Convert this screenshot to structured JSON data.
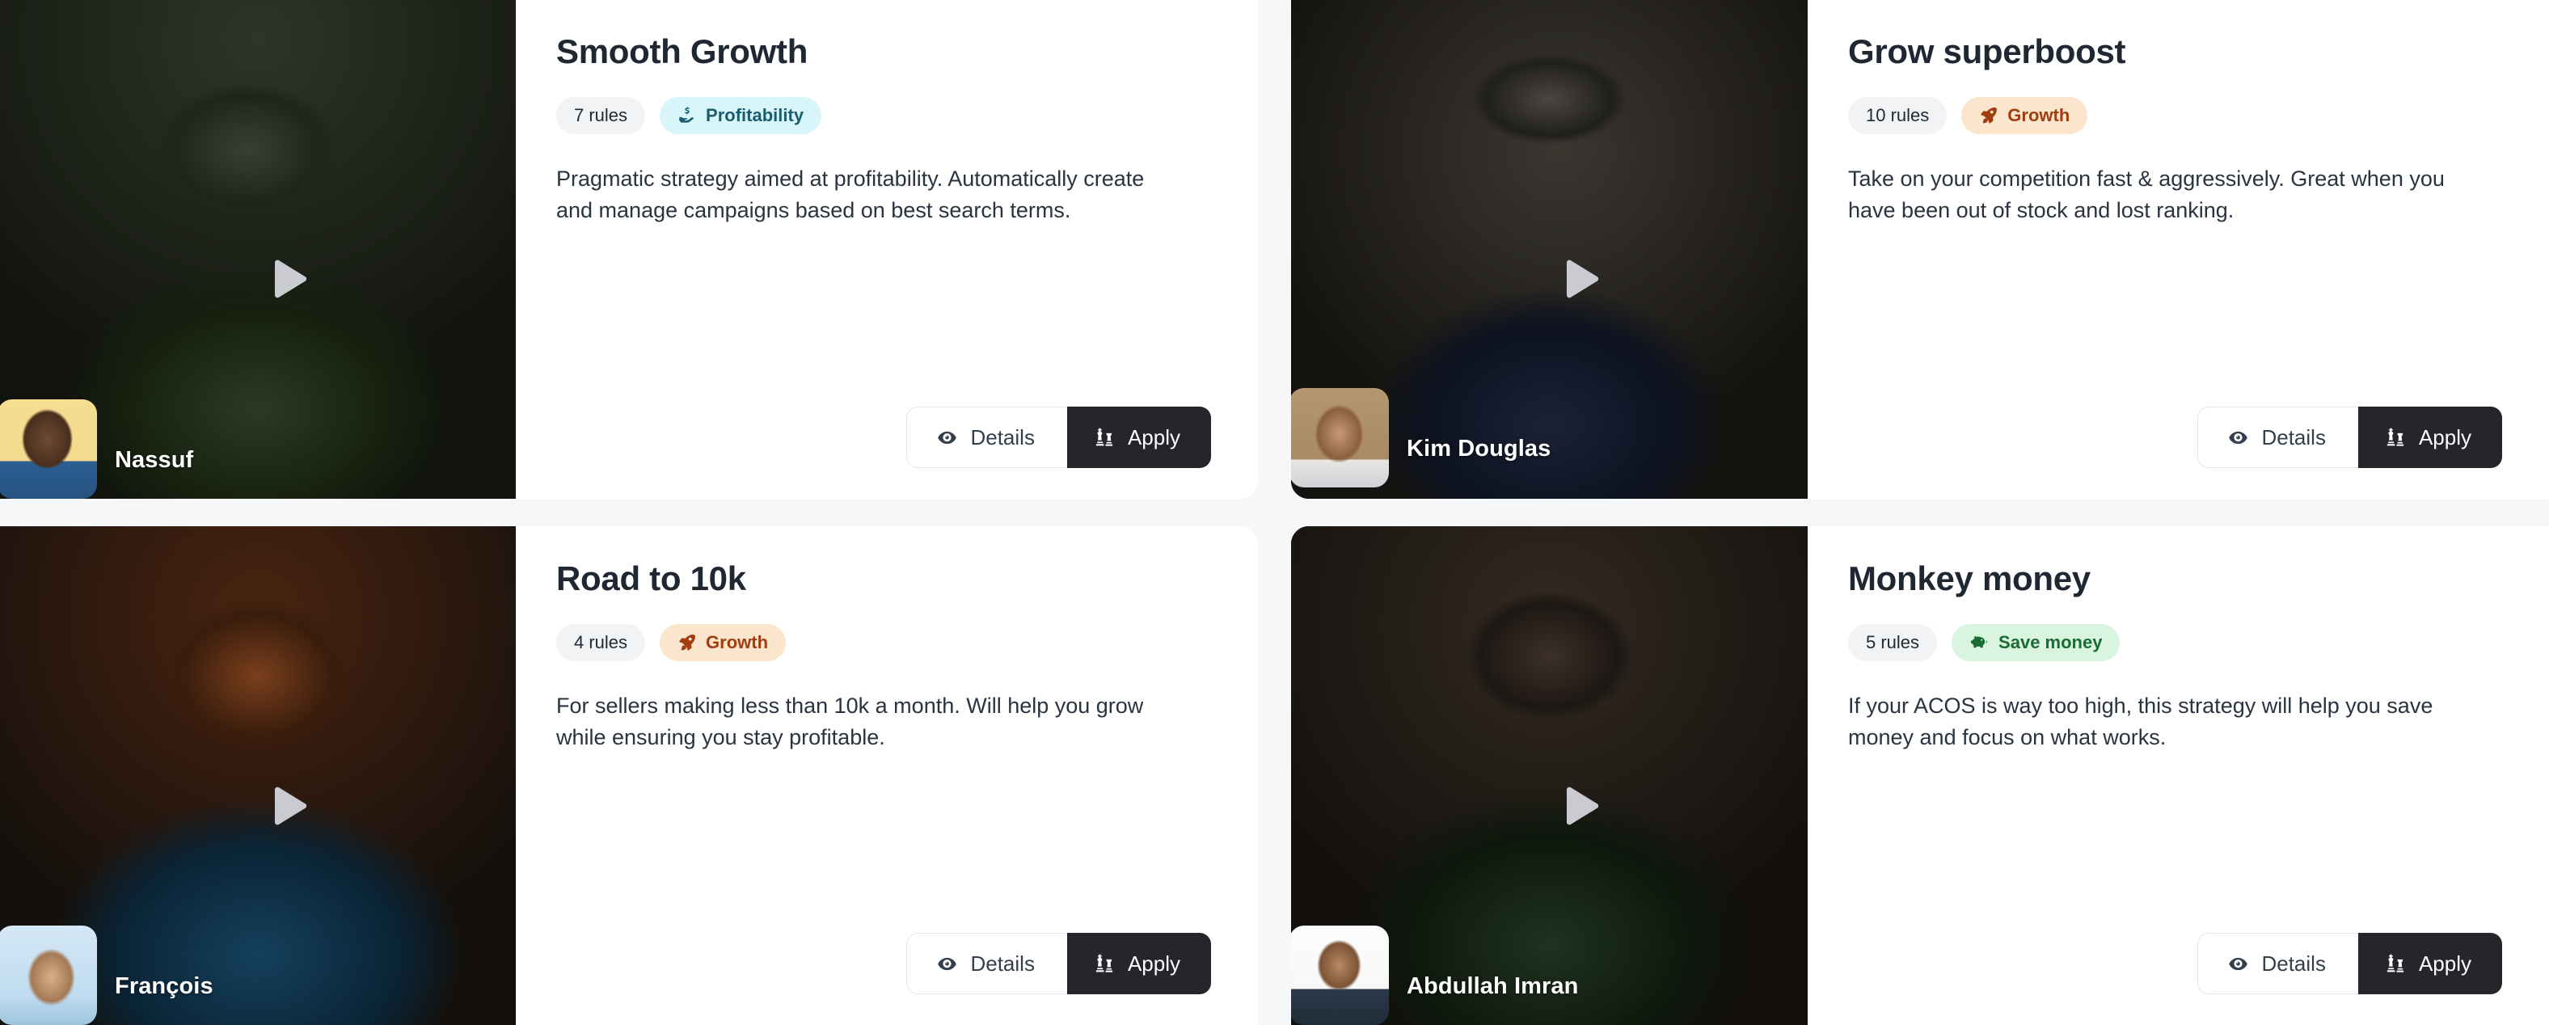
{
  "page": {
    "background_color": "#f6f7f9",
    "card_background": "#ffffff"
  },
  "buttons": {
    "details_label": "Details",
    "apply_label": "Apply",
    "details_icon": "eye-icon",
    "apply_icon": "chess-strategy-icon",
    "apply_bg": "#25262b"
  },
  "badge_styles": {
    "Profitability": {
      "bg": "#d8f5fa",
      "fg": "#1b5c70",
      "icon": "hand-holding-dollar-icon"
    },
    "Growth": {
      "bg": "#fbe6cd",
      "fg": "#a03e10",
      "icon": "rocket-icon"
    },
    "Save money": {
      "bg": "#d9f5e0",
      "fg": "#1a6b34",
      "icon": "piggy-bank-icon"
    }
  },
  "cards": [
    {
      "title": "Smooth Growth",
      "rules_label": "7 rules",
      "category_label": "Profitability",
      "category_icon": "hand-holding-dollar-icon",
      "description": "Pragmatic strategy aimed at profitability. Automatically create and manage campaigns based on best search terms.",
      "presenter_name": "Nassuf",
      "media_icon": "play-icon",
      "details_label": "Details",
      "apply_label": "Apply"
    },
    {
      "title": "Grow superboost",
      "rules_label": "10 rules",
      "category_label": "Growth",
      "category_icon": "rocket-icon",
      "description": "Take on your competition fast & aggressively. Great when you have been out of stock and lost ranking.",
      "presenter_name": "Kim Douglas",
      "media_icon": "play-icon",
      "details_label": "Details",
      "apply_label": "Apply"
    },
    {
      "title": "Road to 10k",
      "rules_label": "4 rules",
      "category_label": "Growth",
      "category_icon": "rocket-icon",
      "description": "For sellers making less than 10k a month. Will help you grow while ensuring you stay profitable.",
      "presenter_name": "François",
      "media_icon": "play-icon",
      "details_label": "Details",
      "apply_label": "Apply"
    },
    {
      "title": "Monkey money",
      "rules_label": "5 rules",
      "category_label": "Save money",
      "category_icon": "piggy-bank-icon",
      "description": "If your ACOS is way too high, this strategy will help you save money and focus on what works.",
      "presenter_name": "Abdullah Imran",
      "media_icon": "play-icon",
      "details_label": "Details",
      "apply_label": "Apply"
    }
  ]
}
